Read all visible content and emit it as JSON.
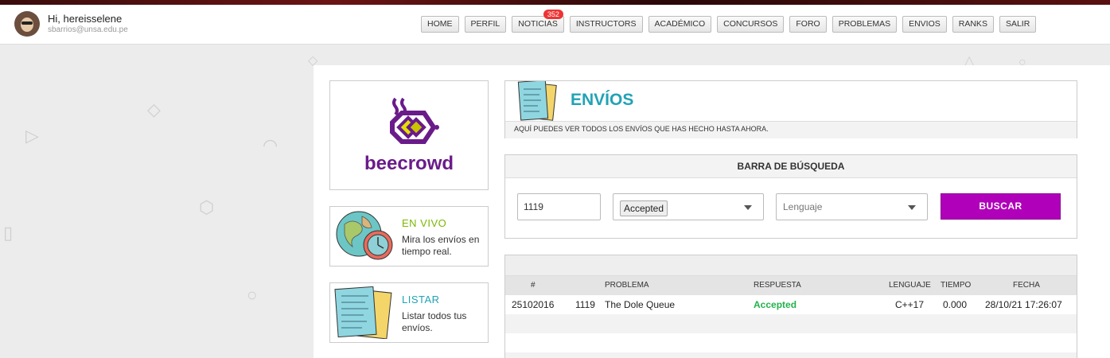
{
  "user": {
    "greeting": "Hi,",
    "name": "hereisselene",
    "email": "sbarrios@unsa.edu.pe"
  },
  "nav": [
    {
      "label": "HOME"
    },
    {
      "label": "PERFIL"
    },
    {
      "label": "NOTICIAS",
      "badge": "352"
    },
    {
      "label": "INSTRUCTORS"
    },
    {
      "label": "ACADÉMICO"
    },
    {
      "label": "CONCURSOS"
    },
    {
      "label": "FORO"
    },
    {
      "label": "PROBLEMAS"
    },
    {
      "label": "ENVIOS"
    },
    {
      "label": "RANKS"
    },
    {
      "label": "SALIR"
    }
  ],
  "logo": {
    "text": "beecrowd"
  },
  "sidebar": {
    "live": {
      "title": "EN VIVO",
      "desc": "Mira los envíos en tiempo real."
    },
    "list": {
      "title": "LISTAR",
      "desc": "Listar todos tus envíos."
    }
  },
  "header": {
    "title": "ENVÍOS",
    "subtitle": "AQUÍ PUEDES VER TODOS LOS ENVÍOS QUE HAS HECHO HASTA AHORA."
  },
  "search": {
    "title": "BARRA DE BÚSQUEDA",
    "problem_value": "1119",
    "answer_value": "Accepted",
    "language_placeholder": "Lenguaje",
    "button_label": "BUSCAR"
  },
  "table": {
    "headers": {
      "id": "#",
      "problem": "PROBLEMA",
      "answer": "RESPUESTA",
      "language": "LENGUAJE",
      "time": "TIEMPO",
      "date": "FECHA"
    },
    "rows": [
      {
        "id": "25102016",
        "problem_num": "1119",
        "problem_name": "The Dole Queue",
        "answer": "Accepted",
        "language": "C++17",
        "time": "0.000",
        "date": "28/10/21 17:26:07"
      }
    ]
  },
  "colors": {
    "accent": "#b000b9",
    "teal": "#21a3b5",
    "green": "#7ab800",
    "accepted": "#22b24c"
  }
}
